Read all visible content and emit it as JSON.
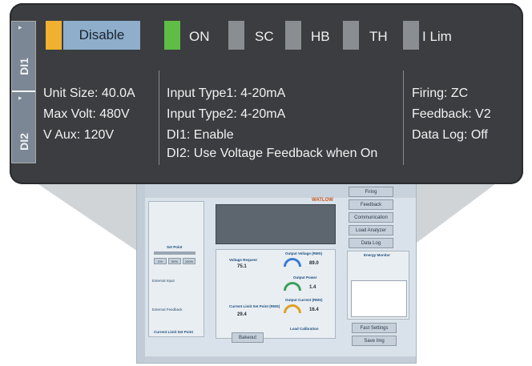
{
  "status_indicators": {
    "disable": {
      "label": "Disable",
      "color": "#f0b030"
    },
    "items": [
      {
        "label": "ON",
        "color": "#5fbd46"
      },
      {
        "label": "SC",
        "color": "#8a8d91"
      },
      {
        "label": "HB",
        "color": "#8a8d91"
      },
      {
        "label": "TH",
        "color": "#8a8d91"
      },
      {
        "label": "I Lim",
        "color": "#8a8d91"
      }
    ]
  },
  "tabs": {
    "di1": "DI1",
    "di2": "DI2"
  },
  "col1": {
    "unit_size": "Unit Size: 40.0A",
    "max_volt": "Max Volt: 480V",
    "v_aux": "V Aux: 120V"
  },
  "col2": {
    "input_type1": "Input Type1: 4-20mA",
    "input_type2": "Input Type2: 4-20mA",
    "di1": "DI1: Enable",
    "di2": "DI2: Use Voltage Feedback when On"
  },
  "col3": {
    "firing": "Firing: ZC",
    "feedback": "Feedback: V2",
    "data_log": "Data Log: Off"
  },
  "background_app": {
    "brand": "WATLOW",
    "buttons": [
      "Firing",
      "Feedback",
      "Communication",
      "Load Analyzer",
      "Data Log",
      "Fast Settings",
      "Save Img",
      "Bakeout"
    ],
    "labels": {
      "set_point": "Set Point",
      "voltage_request": "Voltage Request",
      "output_voltage": "Output Voltage (RMS)",
      "output_power": "Output Power",
      "output_current": "Output Current (RMS)",
      "current_limit_set_point_rms": "Current Limit Set Point (RMS)",
      "current_limit_set_point": "Current Limit Set Point",
      "load_calibration": "Load Calibration",
      "energy_monitor": "Energy Monitor",
      "external_input": "External Input",
      "external_feedback": "External Feedback"
    },
    "values": {
      "voltage_request": "75.1",
      "output_voltage": "89.0",
      "output_power": "1.4",
      "output_current": "16.4",
      "current_limit": "29.4"
    },
    "percent_buttons": [
      "0%",
      "50%",
      "100%"
    ]
  }
}
